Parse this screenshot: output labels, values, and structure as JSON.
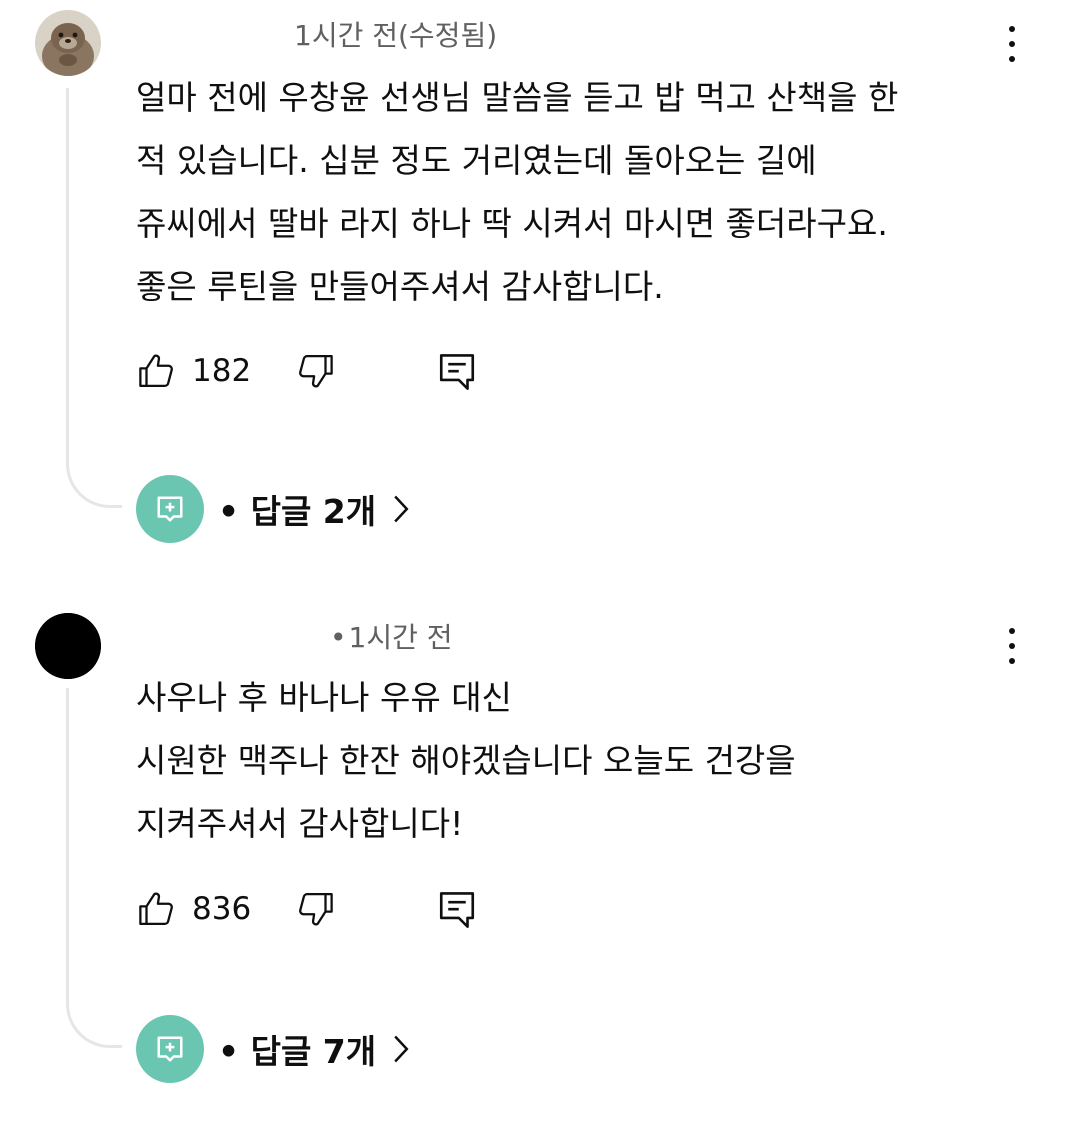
{
  "comments": [
    {
      "time": "1시간 전(수정됨)",
      "avatar_icon": "otter-avatar",
      "lines": [
        "얼마 전에 우창윤 선생님 말씀을 듣고 밥 먹고 산책을 한",
        "적 있습니다. 십분 정도 거리였는데 돌아오는 길에",
        "쥬씨에서 딸바 라지 하나 딱 시켜서 마시면 좋더라구요.",
        "좋은 루틴을 만들어주셔서 감사합니다."
      ],
      "likes": "182",
      "replies": "• 답글 2개"
    },
    {
      "time": "1시간 전",
      "separator": "•",
      "avatar_icon": "black-avatar",
      "lines": [
        "사우나 후 바나나 우유 대신",
        "시원한 맥주나 한잔 해야겠습니다 오늘도 건강을",
        "지켜주셔서 감사합니다!"
      ],
      "likes": "836",
      "replies": "• 답글 7개"
    }
  ],
  "colors": {
    "reply_badge": "#6ac6b0",
    "text": "#0f0f0f",
    "meta": "#606060",
    "thread_line": "#e6e6e6"
  }
}
